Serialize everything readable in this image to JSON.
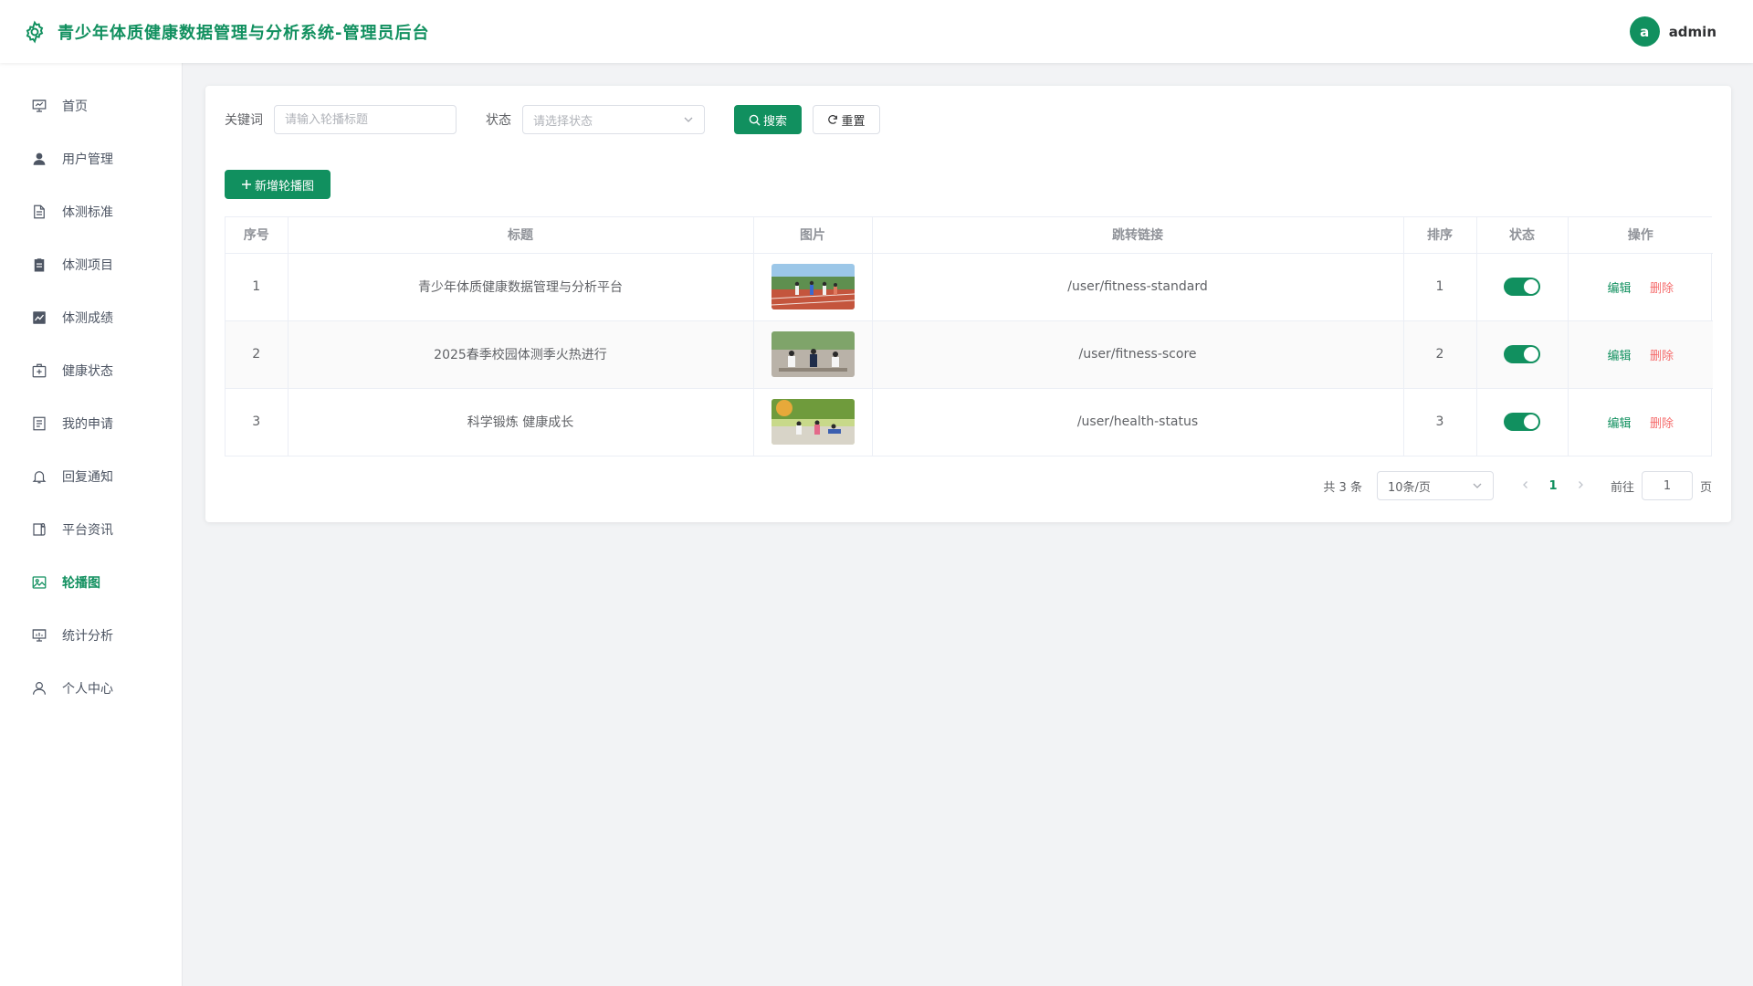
{
  "header": {
    "title": "青少年体质健康数据管理与分析系统-管理员后台",
    "avatar_letter": "a",
    "username": "admin",
    "accent": "#11905f"
  },
  "sidebar": {
    "items": [
      {
        "label": "首页",
        "icon": "dashboard-icon"
      },
      {
        "label": "用户管理",
        "icon": "user-icon"
      },
      {
        "label": "体测标准",
        "icon": "document-icon"
      },
      {
        "label": "体测项目",
        "icon": "clipboard-icon"
      },
      {
        "label": "体测成绩",
        "icon": "chart-icon"
      },
      {
        "label": "健康状态",
        "icon": "medical-box-icon"
      },
      {
        "label": "我的申请",
        "icon": "tickets-icon"
      },
      {
        "label": "回复通知",
        "icon": "bell-icon"
      },
      {
        "label": "平台资讯",
        "icon": "news-icon"
      },
      {
        "label": "轮播图",
        "icon": "picture-icon",
        "active": true
      },
      {
        "label": "统计分析",
        "icon": "statistics-icon"
      },
      {
        "label": "个人中心",
        "icon": "person-icon"
      }
    ]
  },
  "filters": {
    "keyword_label": "关键词",
    "keyword_placeholder": "请输入轮播标题",
    "keyword_value": "",
    "status_label": "状态",
    "status_placeholder": "请选择状态",
    "search_label": "搜索",
    "reset_label": "重置"
  },
  "toolbar": {
    "add_label": "新增轮播图"
  },
  "table": {
    "columns": [
      "序号",
      "标题",
      "图片",
      "跳转链接",
      "排序",
      "状态",
      "操作"
    ],
    "rows": [
      {
        "index": "1",
        "title": "青少年体质健康数据管理与分析平台",
        "link": "/user/fitness-standard",
        "sort": "1",
        "enabled": true
      },
      {
        "index": "2",
        "title": "2025春季校园体测季火热进行",
        "link": "/user/fitness-score",
        "sort": "2",
        "enabled": true
      },
      {
        "index": "3",
        "title": "科学锻炼 健康成长",
        "link": "/user/health-status",
        "sort": "3",
        "enabled": true
      }
    ],
    "edit_label": "编辑",
    "delete_label": "删除"
  },
  "pagination": {
    "total": "共 3 条",
    "page_size": "10条/页",
    "current_page": "1",
    "goto_label": "前往",
    "goto_value": "1",
    "unit_label": "页"
  }
}
